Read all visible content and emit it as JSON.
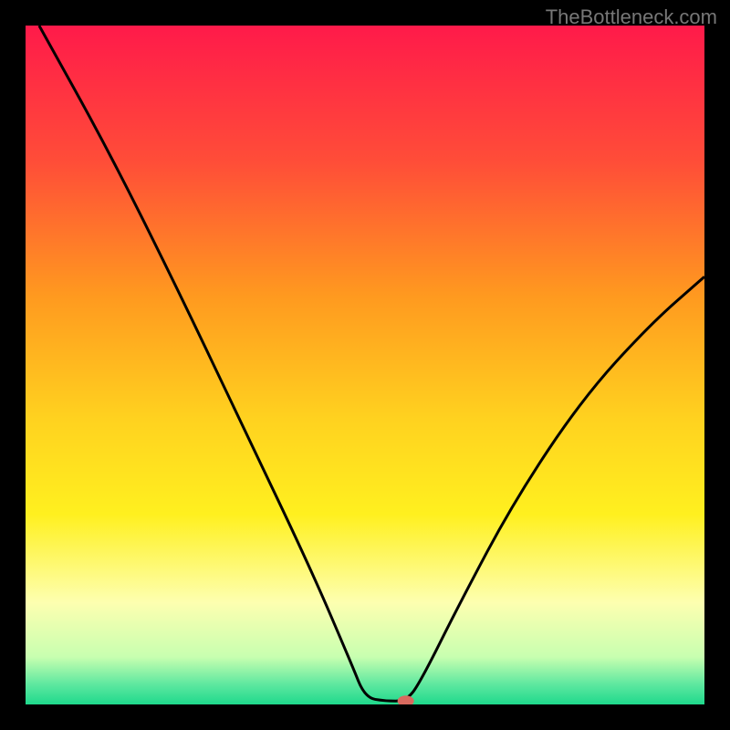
{
  "watermark": "TheBottleneck.com",
  "chart_data": {
    "type": "line",
    "title": "",
    "xlabel": "",
    "ylabel": "",
    "xlim": [
      0,
      100
    ],
    "ylim": [
      0,
      100
    ],
    "series": [
      {
        "name": "bottleneck-curve",
        "points": [
          {
            "x": 2,
            "y": 100
          },
          {
            "x": 12,
            "y": 82
          },
          {
            "x": 22,
            "y": 62
          },
          {
            "x": 32,
            "y": 41
          },
          {
            "x": 42,
            "y": 20
          },
          {
            "x": 48,
            "y": 6
          },
          {
            "x": 50,
            "y": 1
          },
          {
            "x": 53,
            "y": 0.5
          },
          {
            "x": 56,
            "y": 0.5
          },
          {
            "x": 58,
            "y": 3
          },
          {
            "x": 64,
            "y": 15
          },
          {
            "x": 72,
            "y": 30
          },
          {
            "x": 82,
            "y": 45
          },
          {
            "x": 92,
            "y": 56
          },
          {
            "x": 100,
            "y": 63
          }
        ]
      }
    ],
    "marker": {
      "x": 56,
      "y": 0.5,
      "color": "#d96a5f"
    },
    "gradient_stops": [
      {
        "offset": 0,
        "color": "#ff1a4a"
      },
      {
        "offset": 20,
        "color": "#ff4d38"
      },
      {
        "offset": 40,
        "color": "#ff9a1f"
      },
      {
        "offset": 58,
        "color": "#ffd21f"
      },
      {
        "offset": 72,
        "color": "#fff01f"
      },
      {
        "offset": 85,
        "color": "#fdffb0"
      },
      {
        "offset": 93,
        "color": "#c8ffb0"
      },
      {
        "offset": 97,
        "color": "#5fe8a0"
      },
      {
        "offset": 100,
        "color": "#1fd98c"
      }
    ]
  }
}
